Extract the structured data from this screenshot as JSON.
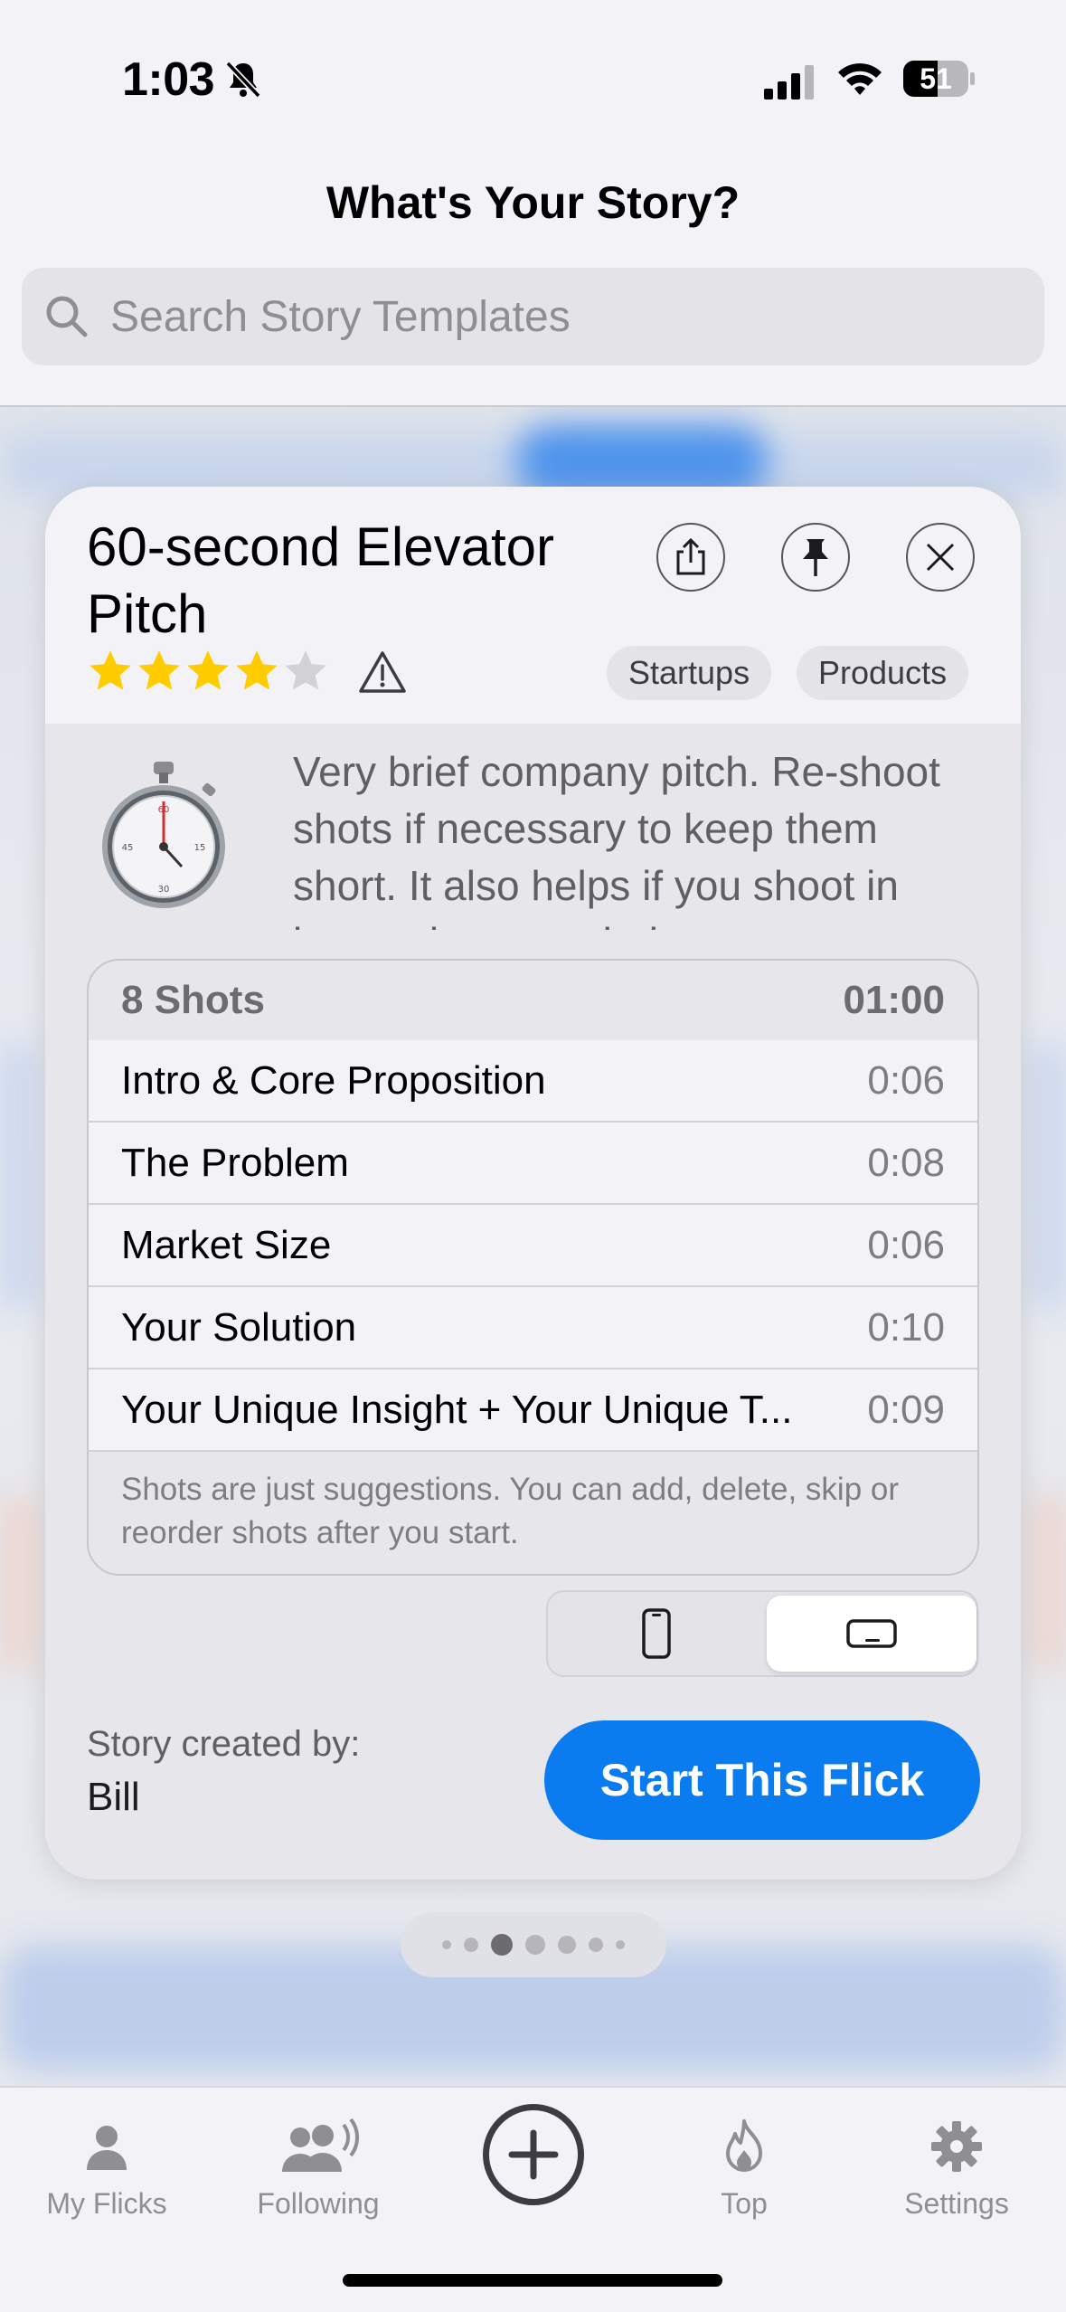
{
  "status_bar": {
    "time": "1:03",
    "battery": "51"
  },
  "nav": {
    "title": "What's Your Story?"
  },
  "search": {
    "placeholder": "Search Story Templates"
  },
  "card": {
    "title": "60-second Elevator Pitch",
    "rating": 4,
    "rating_max": 5,
    "tags": [
      "Startups",
      "Products"
    ],
    "description": "Very brief company pitch. Re-shoot shots if necessary to keep them short. It also helps if you shoot in interesting or varied",
    "shots_count": "8 Shots",
    "total_duration": "01:00",
    "shots": [
      {
        "name": "Intro & Core Proposition",
        "duration": "0:06"
      },
      {
        "name": "The Problem",
        "duration": "0:08"
      },
      {
        "name": "Market Size",
        "duration": "0:06"
      },
      {
        "name": "Your Solution",
        "duration": "0:10"
      },
      {
        "name": "Your Unique Insight + Your Unique T...",
        "duration": "0:09"
      }
    ],
    "shots_note": "Shots are just suggestions. You can add, delete, skip or reorder shots after you start.",
    "creator_label": "Story created by:",
    "creator_name": "Bill",
    "start_button": "Start This Flick",
    "orientation_selected": "landscape"
  },
  "page_indicator": {
    "count": 7,
    "active_index": 2
  },
  "tabbar": {
    "tabs": [
      {
        "label": "My Flicks",
        "icon": "person-icon"
      },
      {
        "label": "Following",
        "icon": "people-icon"
      },
      {
        "label": "",
        "icon": "plus-circle-icon"
      },
      {
        "label": "Top",
        "icon": "flame-icon"
      },
      {
        "label": "Settings",
        "icon": "gear-icon"
      }
    ]
  },
  "colors": {
    "accent": "#0a7cf0",
    "star": "#ffcc00"
  }
}
